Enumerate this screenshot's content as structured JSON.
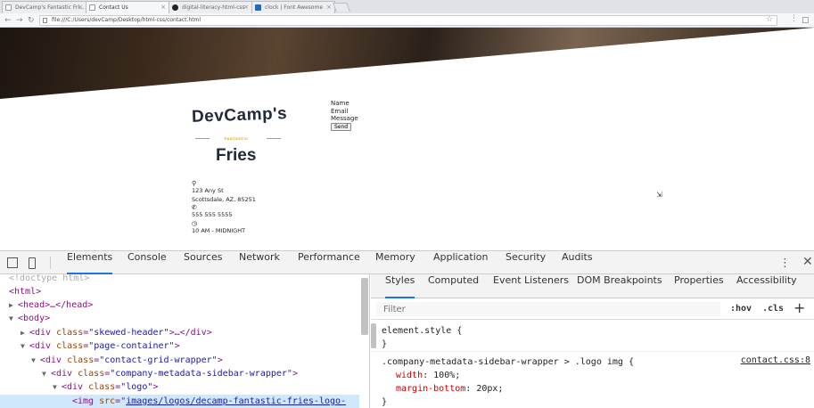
{
  "browser": {
    "tabs": [
      {
        "label": "DevCamp's Fantastic Fri..."
      },
      {
        "label": "Contact Us"
      },
      {
        "label": "digital-literacy-html-css"
      },
      {
        "label": "clock | Font Awesome"
      }
    ],
    "url": "file:///C:/Users/devCamp/Desktop/html-css/contact.html"
  },
  "page": {
    "logo": {
      "top": "DevCamp's",
      "middle": "FANTASTIC",
      "bottom": "Fries"
    },
    "form": {
      "name_label": "Name",
      "email_label": "Email",
      "message_label": "Message",
      "send_label": "Send"
    },
    "contact": {
      "address_line1": "123 Any St",
      "address_line2": "Scottsdale, AZ, 85251",
      "phone": "555 555 5555",
      "hours": "10 AM - MIDNIGHT"
    }
  },
  "devtools": {
    "tabs": [
      "Elements",
      "Console",
      "Sources",
      "Network",
      "Performance",
      "Memory",
      "Application",
      "Security",
      "Audits"
    ],
    "active_tab": "Elements",
    "elements": {
      "doctype": "<!doctype html>",
      "html_open": "<html>",
      "head": "<head>…</head>",
      "body_open": "<body>",
      "div_skewed_attr": "class",
      "div_skewed_val": "\"skewed-header\"",
      "div_page_val": "\"page-container\"",
      "div_grid_val": "\"contact-grid-wrapper\"",
      "div_sidebar_val": "\"company-metadata-sidebar-wrapper\"",
      "div_logo_val": "\"logo\"",
      "img_src_val": "images/logos/decamp-fantastic-fries-logo-"
    },
    "styles_tabs": [
      "Styles",
      "Computed",
      "Event Listeners",
      "DOM Breakpoints",
      "Properties",
      "Accessibility"
    ],
    "filter_placeholder": "Filter",
    "hov": ":hov",
    "cls": ".cls",
    "rules": {
      "element_style": "element.style {",
      "element_style_close": "}",
      "selector": ".company-metadata-sidebar-wrapper > .logo img {",
      "source": "contact.css:8",
      "decl1_prop": "width",
      "decl1_val": "100%;",
      "decl2_prop": "margin-bottom",
      "decl2_val": "20px;",
      "close": "}"
    }
  }
}
